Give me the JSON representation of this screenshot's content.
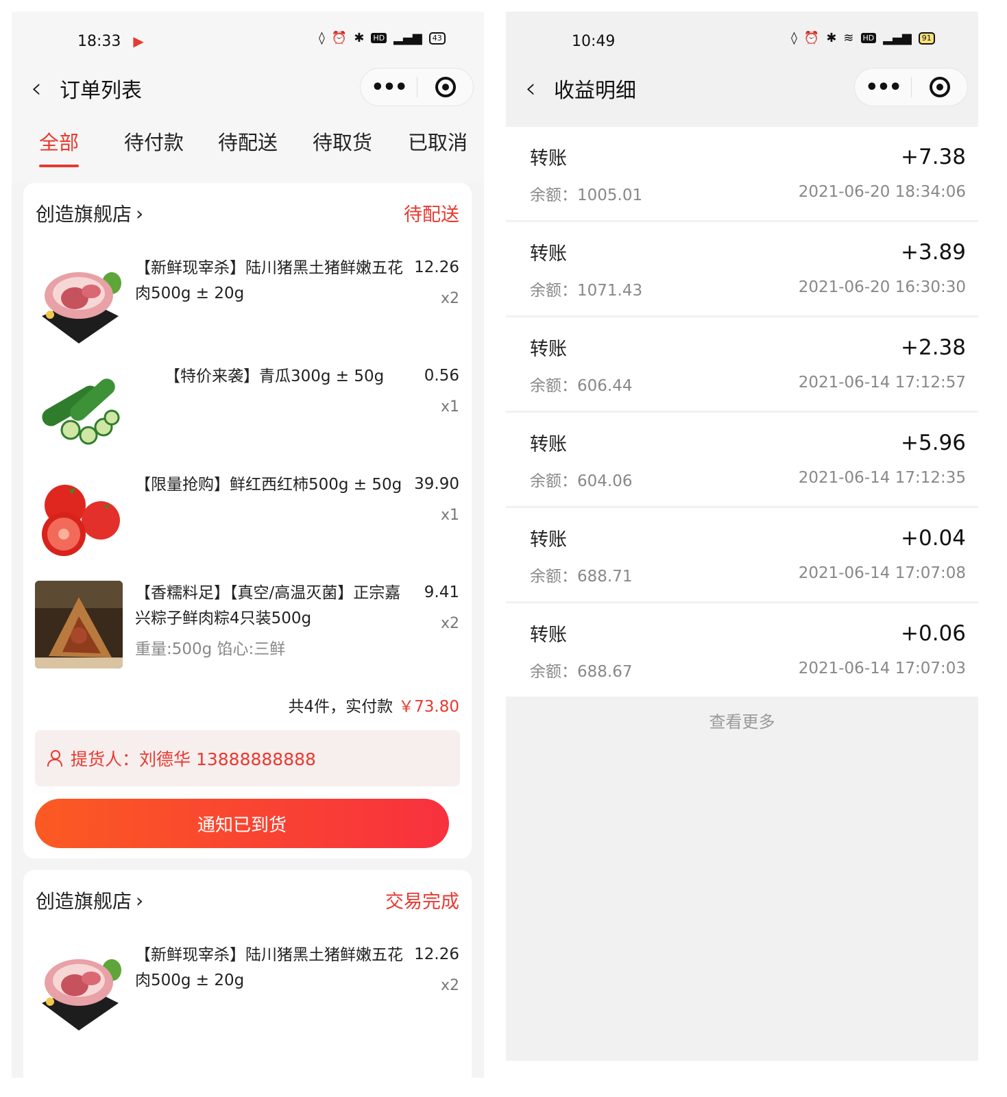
{
  "left": {
    "status": {
      "time": "18:33",
      "battery": "43"
    },
    "nav": {
      "title": "订单列表",
      "more": "•••"
    },
    "tabs": [
      "全部",
      "待付款",
      "待配送",
      "待取货",
      "已取消"
    ],
    "orders": [
      {
        "shop": "创造旗舰店",
        "status": "待配送",
        "items": [
          {
            "name": "【新鲜现宰杀】陆川猪黑土猪鲜嫩五花肉500g ± 20g",
            "price": "12.26",
            "qty": "x2",
            "spec": "",
            "image": "pork-belly"
          },
          {
            "name": "【特价来袭】青瓜300g ± 50g",
            "price": "0.56",
            "qty": "x1",
            "spec": "",
            "image": "cucumber"
          },
          {
            "name": "【限量抢购】鲜红西红柿500g ± 50g",
            "price": "39.90",
            "qty": "x1",
            "spec": "",
            "image": "tomato"
          },
          {
            "name": "【香糯料足】【真空/高温灭菌】正宗嘉兴粽子鲜肉粽4只装500g",
            "price": "9.41",
            "qty": "x2",
            "spec": "重量:500g 馅心:三鲜",
            "image": "zongzi"
          }
        ],
        "summary_label": "共4件，实付款",
        "summary_amount": "￥73.80",
        "picker": "提货人：刘德华 13888888888",
        "action": "通知已到货"
      },
      {
        "shop": "创造旗舰店",
        "status": "交易完成",
        "items": [
          {
            "name": "【新鲜现宰杀】陆川猪黑土猪鲜嫩五花肉500g ± 20g",
            "price": "12.26",
            "qty": "x2",
            "spec": "",
            "image": "pork-belly"
          }
        ]
      }
    ]
  },
  "right": {
    "status": {
      "time": "10:49",
      "battery": "91"
    },
    "nav": {
      "title": "收益明细",
      "more": "•••"
    },
    "records": [
      {
        "type": "转账",
        "amount": "+7.38",
        "balance": "余额：1005.01",
        "time": "2021-06-20 18:34:06"
      },
      {
        "type": "转账",
        "amount": "+3.89",
        "balance": "余额：1071.43",
        "time": "2021-06-20 16:30:30"
      },
      {
        "type": "转账",
        "amount": "+2.38",
        "balance": "余额：606.44",
        "time": "2021-06-14 17:12:57"
      },
      {
        "type": "转账",
        "amount": "+5.96",
        "balance": "余额：604.06",
        "time": "2021-06-14 17:12:35"
      },
      {
        "type": "转账",
        "amount": "+0.04",
        "balance": "余额：688.71",
        "time": "2021-06-14 17:07:08"
      },
      {
        "type": "转账",
        "amount": "+0.06",
        "balance": "余额：688.67",
        "time": "2021-06-14 17:07:03"
      }
    ],
    "see_more": "查看更多"
  },
  "colors": {
    "accent": "#e8392f",
    "button_start": "#fb5a22",
    "button_end": "#f8313e"
  }
}
